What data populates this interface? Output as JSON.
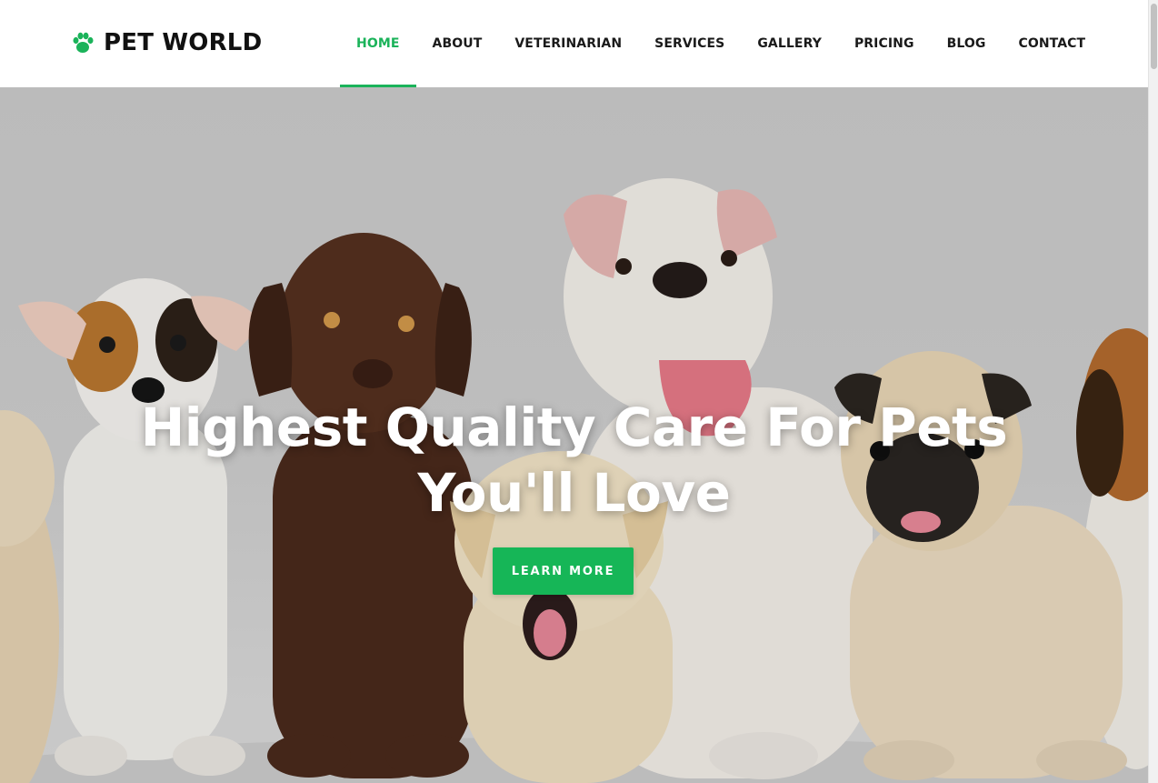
{
  "brand": {
    "name": "PET WORLD",
    "icon": "paw-icon",
    "accent_color": "#1bb35a"
  },
  "nav": {
    "active_index": 0,
    "items": [
      {
        "label": "HOME"
      },
      {
        "label": "ABOUT"
      },
      {
        "label": "VETERINARIAN"
      },
      {
        "label": "SERVICES"
      },
      {
        "label": "GALLERY"
      },
      {
        "label": "PRICING"
      },
      {
        "label": "BLOG"
      },
      {
        "label": "CONTACT"
      }
    ]
  },
  "hero": {
    "heading_line1": "Highest Quality Care For Pets",
    "heading_line2": "You'll Love",
    "cta_label": "LEARN MORE",
    "cta_color": "#16b657",
    "background_color": "#cccccc"
  }
}
